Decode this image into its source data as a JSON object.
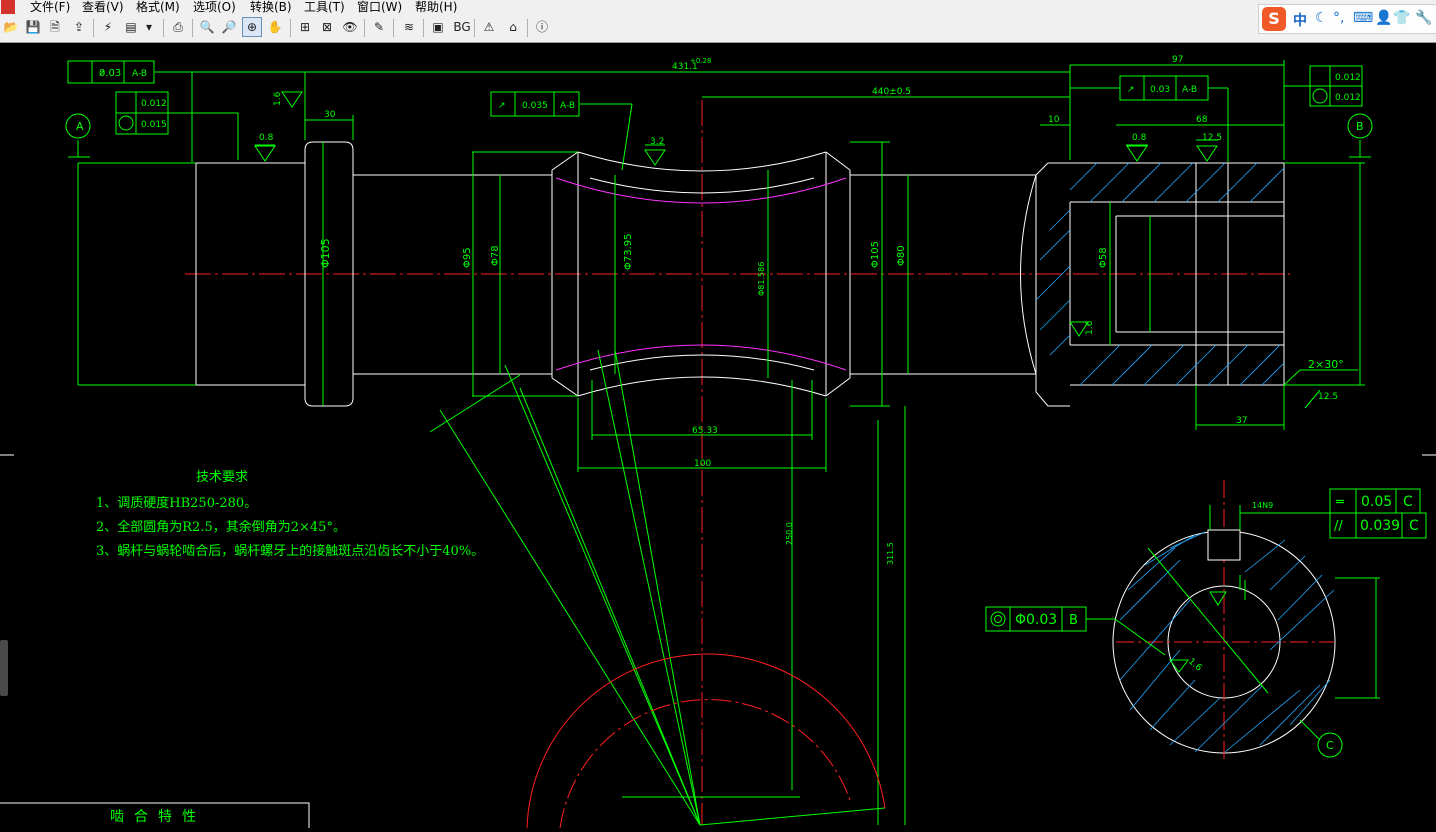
{
  "menu": {
    "app_icon_label": "",
    "items": [
      "文件(F)",
      "查看(V)",
      "格式(M)",
      "选项(O)",
      "转换(B)",
      "工具(T)",
      "窗口(W)",
      "帮助(H)"
    ]
  },
  "toolbar": {
    "bg_label": "BG"
  },
  "ime": {
    "logo": "S",
    "mode": "中"
  },
  "drawing": {
    "tech_title": "技术要求",
    "tech_lines": [
      "1、调质硬度HB250-280。",
      "2、全部圆角为R2.5，其余倒角为2×45°。",
      "3、蜗杆与蜗轮啮合后，蜗杆螺牙上的接触斑点沿齿长不小于40%。"
    ],
    "mesh_table_title": "啮合特性",
    "datums": {
      "A": "A",
      "B": "B",
      "C": "C"
    },
    "fcf": {
      "runout_left": {
        "sym": "↗",
        "tol": "0.03",
        "ref": "A-B"
      },
      "cyl_left_1": "0.012",
      "cyl_left_2": "0.015",
      "runout_mid": {
        "sym": "↗",
        "tol": "0.035",
        "ref": "A-B"
      },
      "runout_right": {
        "sym": "↗",
        "tol": "0.03",
        "ref": "A-B"
      },
      "cyl_right_1": "0.012",
      "cyl_right_2": "0.012",
      "sym_c": {
        "sym": "═",
        "tol": "0.05",
        "ref": "C"
      },
      "par_c": {
        "sym": "//",
        "tol": "0.039",
        "ref": "C"
      },
      "conc_b": {
        "sym": "◎",
        "tol": "Φ0.03",
        "ref": "B"
      }
    },
    "dims": {
      "overall": "431.1",
      "overall_tol": "+0.28",
      "right_len": "97",
      "mid_len": "440±0.5",
      "d105_left": "Φ105",
      "d95": "Φ95",
      "d78": "Φ78",
      "d73": "Φ73.95",
      "d_pitch": "Φ81.586",
      "d105_right": "Φ105",
      "d80": "Φ80",
      "d58": "Φ58",
      "len_30": "30",
      "len_10": "10",
      "len_68": "68",
      "len_37": "37",
      "len_100": "100",
      "len_6533": "65.33",
      "len_250": "250.0",
      "len_311": "311.5",
      "chamfer": "2×30°",
      "rough_08_a": "0.8",
      "rough_08_b": "0.8",
      "rough_16": "1.6",
      "rough_32": "3.2",
      "rough_125": "12.5",
      "rough_125b": "12.5",
      "rough_16c": "1.6",
      "angle_12": "1.6",
      "keyway": "14N9"
    }
  }
}
